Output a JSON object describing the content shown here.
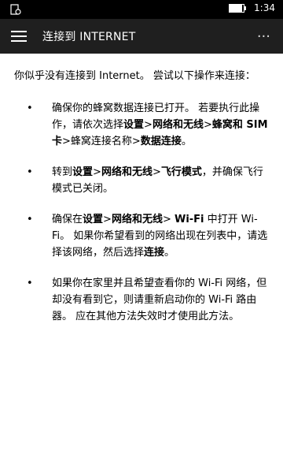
{
  "status_bar": {
    "time": "1:34",
    "battery_level": 0.9
  },
  "app_bar": {
    "title": "连接到 INTERNET",
    "more_label": "···"
  },
  "content": {
    "intro": "你似乎没有连接到 Internet。 尝试以下操作来连接：",
    "bullet": "•",
    "items": [
      {
        "p1": "确保你的蜂窝数据连接已打开。 若要执行此操作，请依次选择",
        "b1": "设置",
        "p2": ">",
        "b2": "网络和无线",
        "p3": ">",
        "b3": "蜂窝和 SIM 卡",
        "p4": ">蜂窝连接名称>",
        "b4": "数据连接",
        "p5": "。"
      },
      {
        "p1": "转到",
        "b1": "设置",
        "p2": ">",
        "b2": "网络和无线",
        "p3": ">",
        "b3": "飞行模式",
        "p4": "，并确保飞行模式已关闭。"
      },
      {
        "p1": "确保在",
        "b1": "设置",
        "p2": ">",
        "b2": "网络和无线",
        "p3": "> ",
        "b3": "Wi-Fi",
        "p4": " 中打开 Wi-Fi。 如果你希望看到的网络出现在列表中，请选择该网络，然后选择",
        "b4": "连接",
        "p5": "。"
      },
      {
        "p1": "如果你在家里并且希望查看你的 Wi-Fi 网络，但却没有看到它，则请重新启动你的 Wi-Fi 路由器。 应在其他方法失效时才使用此方法。"
      }
    ]
  }
}
